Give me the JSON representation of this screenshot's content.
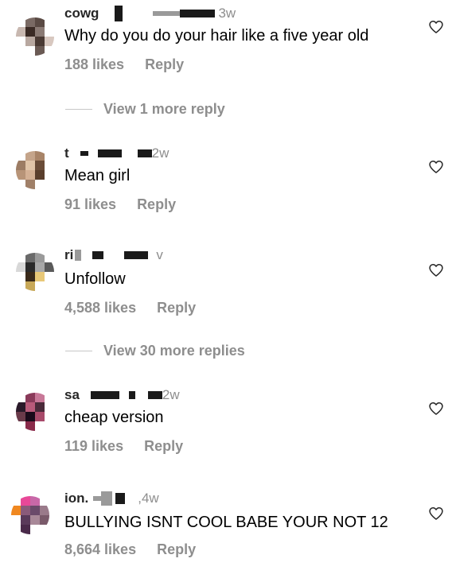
{
  "comments": [
    {
      "username": "cowg",
      "time": "3w",
      "text": "Why do you do your hair like a five year old",
      "likes": "188 likes",
      "reply": "Reply",
      "avatar_colors": [
        "#ffffff",
        "#7a6a64",
        "#5a4a44",
        "#ffffff",
        "#c8b8b0",
        "#3a2a24",
        "#8a7a74",
        "#ffffff",
        "#ffffff",
        "#b8a8a0",
        "#4a3a34",
        "#d8c8c0",
        "#ffffff",
        "#ffffff",
        "#6a5a54",
        "#ffffff"
      ]
    },
    {
      "username": "t",
      "time": "2w",
      "text": "Mean girl",
      "likes": "91 likes",
      "reply": "Reply",
      "avatar_colors": [
        "#ffffff",
        "#c4a48a",
        "#a88468",
        "#ffffff",
        "#9c7c64",
        "#e0c4a8",
        "#6a4c38",
        "#ffffff",
        "#b89478",
        "#d4b094",
        "#5a3e2c",
        "#ffffff",
        "#ffffff",
        "#a08068",
        "#ffffff",
        "#ffffff"
      ]
    },
    {
      "username": "ri",
      "time": "v",
      "text": "Unfollow",
      "likes": "4,588 likes",
      "reply": "Reply",
      "avatar_colors": [
        "#ffffff",
        "#6a6a6a",
        "#9a9a9a",
        "#ffffff",
        "#d8d8d8",
        "#2a2a2a",
        "#a8a8a8",
        "#5a5a5a",
        "#ffffff",
        "#3a2a1a",
        "#e8c878",
        "#ffffff",
        "#ffffff",
        "#c8a858",
        "#ffffff",
        "#ffffff"
      ]
    },
    {
      "username": "sa",
      "time": "2w",
      "text": "cheap version",
      "likes": "119 likes",
      "reply": "Reply",
      "avatar_colors": [
        "#ffffff",
        "#8a3a5a",
        "#c87898",
        "#ffffff",
        "#2a1a2a",
        "#b85a7a",
        "#4a2a3a",
        "#ffffff",
        "#6a3a4a",
        "#1a0a1a",
        "#a84a6a",
        "#ffffff",
        "#ffffff",
        "#8a2a4a",
        "#ffffff",
        "#ffffff"
      ]
    },
    {
      "username": "ion.",
      "time": ",4w",
      "text": "BULLYING ISNT COOL BABE YOUR NOT 12",
      "likes": "8,664 likes",
      "reply": "Reply",
      "avatar_colors": [
        "#ffffff",
        "#e84898",
        "#c868a8",
        "#ffffff",
        "#f08820",
        "#8a5a7a",
        "#6a4a6a",
        "#9a7a8a",
        "#ffffff",
        "#5a3a5a",
        "#a88898",
        "#7a5a6a",
        "#ffffff",
        "#4a2a4a",
        "#ffffff",
        "#ffffff"
      ]
    }
  ],
  "view_more": [
    {
      "label": "View 1 more reply"
    },
    {
      "label": "View 30 more replies"
    }
  ],
  "colors": {
    "secondary_text": "#8e8e8e",
    "primary_text": "#262626"
  }
}
